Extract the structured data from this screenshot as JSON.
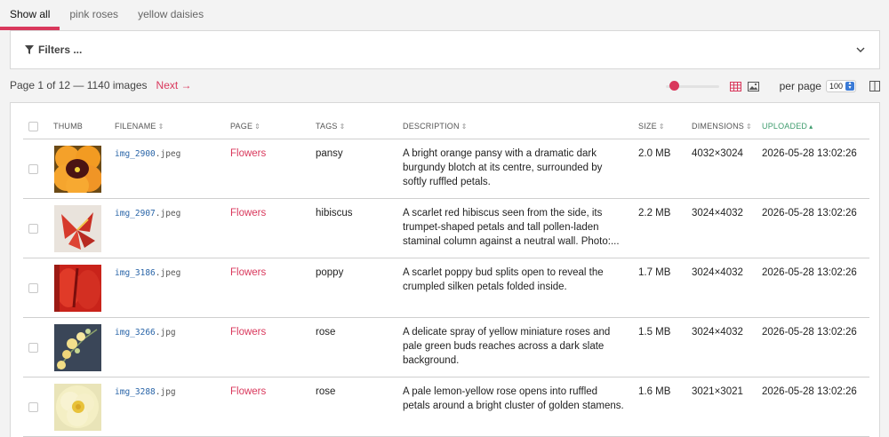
{
  "tabs": [
    {
      "label": "Show all",
      "active": true
    },
    {
      "label": "pink roses",
      "active": false
    },
    {
      "label": "yellow daisies",
      "active": false
    }
  ],
  "filters": {
    "label": "Filters ..."
  },
  "pager": {
    "summary": "Page 1 of 12 — 1140 images",
    "next": "Next →"
  },
  "controls": {
    "thumb_size_level": 0.1,
    "per_page_label": "per page",
    "per_page_value": "100"
  },
  "colors": {
    "accent": "#d9385c",
    "link_blue": "#2a65a8",
    "sorted_green": "#3f9c6e"
  },
  "table": {
    "headers": {
      "thumb": "THUMB",
      "filename": "FILENAME",
      "page": "PAGE",
      "tags": "TAGS",
      "description": "DESCRIPTION",
      "size": "SIZE",
      "dimensions": "DIMENSIONS",
      "uploaded": "UPLOADED"
    },
    "sort_icon": "⇕",
    "sorted_icon": "▴",
    "rows": [
      {
        "name": "img_2900",
        "ext": ".jpeg",
        "page": "Flowers",
        "tags": "pansy",
        "description": "A bright orange pansy with a dramatic dark burgundy blotch at its centre, surrounded by softly ruffled petals.",
        "size": "2.0 MB",
        "dimensions": "4032×3024",
        "uploaded": "2026-05-28 13:02:26",
        "thumb": "orange-pansy"
      },
      {
        "name": "img_2907",
        "ext": ".jpeg",
        "page": "Flowers",
        "tags": "hibiscus",
        "description": "A scarlet red hibiscus seen from the side, its trumpet-shaped petals and tall pollen-laden staminal column against a neutral wall. Photo:...",
        "size": "2.2 MB",
        "dimensions": "3024×4032",
        "uploaded": "2026-05-28 13:02:26",
        "thumb": "red-hibiscus"
      },
      {
        "name": "img_3186",
        "ext": ".jpeg",
        "page": "Flowers",
        "tags": "poppy",
        "description": "A scarlet poppy bud splits open to reveal the crumpled silken petals folded inside.",
        "size": "1.7 MB",
        "dimensions": "3024×4032",
        "uploaded": "2026-05-28 13:02:26",
        "thumb": "red-poppy"
      },
      {
        "name": "img_3266",
        "ext": ".jpg",
        "page": "Flowers",
        "tags": "rose",
        "description": "A delicate spray of yellow miniature roses and pale green buds reaches across a dark slate background.",
        "size": "1.5 MB",
        "dimensions": "3024×4032",
        "uploaded": "2026-05-28 13:02:26",
        "thumb": "yellow-roses-dark"
      },
      {
        "name": "img_3288",
        "ext": ".jpg",
        "page": "Flowers",
        "tags": "rose",
        "description": "A pale lemon-yellow rose opens into ruffled petals around a bright cluster of golden stamens.",
        "size": "1.6 MB",
        "dimensions": "3021×3021",
        "uploaded": "2026-05-28 13:02:26",
        "thumb": "pale-yellow-rose"
      }
    ]
  }
}
